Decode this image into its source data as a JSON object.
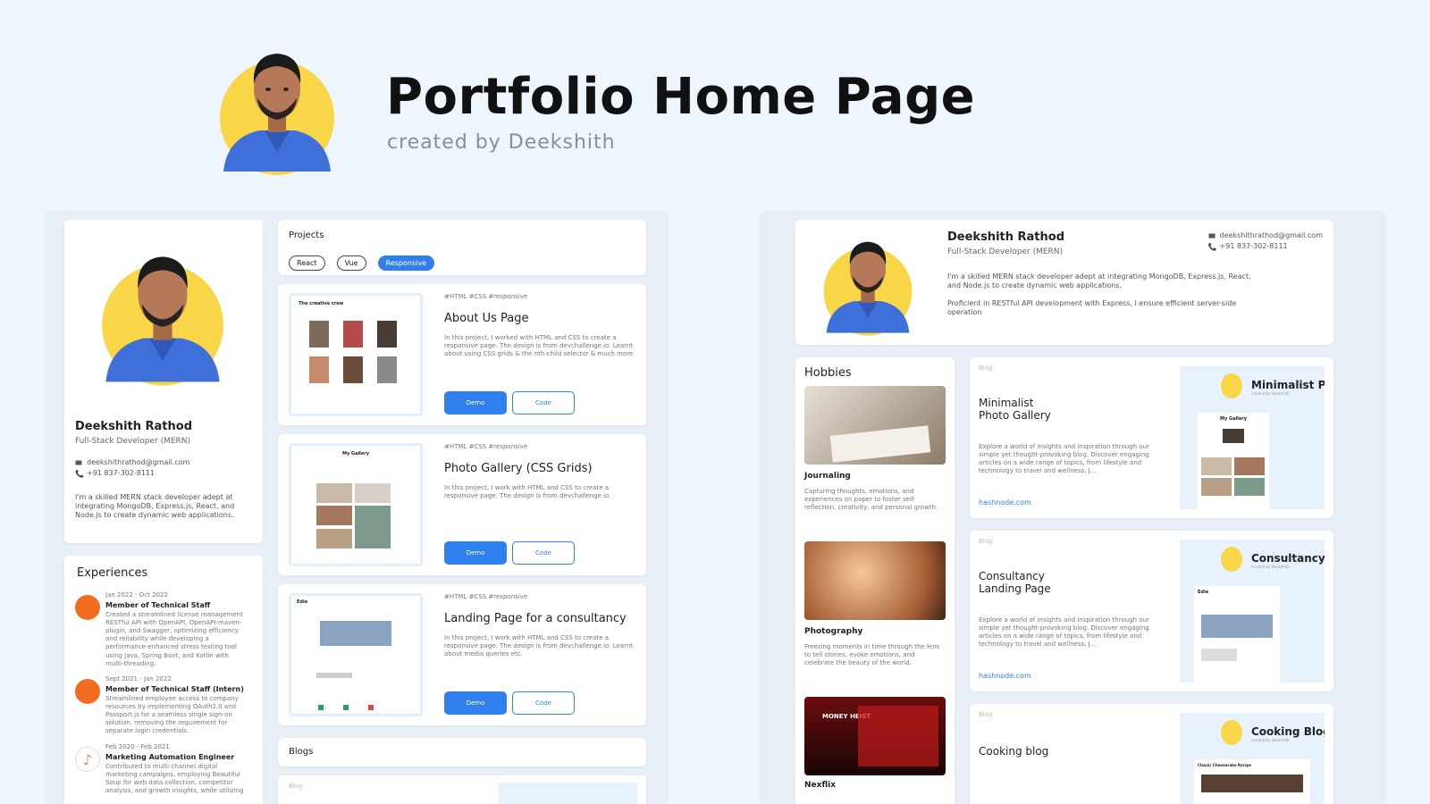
{
  "header": {
    "title": "Portfolio Home Page",
    "subtitle": "created by Deekshith"
  },
  "colors": {
    "accent": "#2f80ed",
    "avatar_bg": "#f9d648",
    "shirt": "#3f6fd8",
    "page_bg": "#eef5fd"
  },
  "left": {
    "profile": {
      "name": "Deekshith Rathod",
      "role": "Full-Stack Developer (MERN)",
      "email": "deekshithrathod@gmail.com",
      "phone": "+91 837-302-8111",
      "bio": "I'm a skilled MERN stack developer adept at integrating MongoDB, Express.js, React, and Node.js to create dynamic web applications."
    },
    "experiences": {
      "title": "Experiences",
      "items": [
        {
          "date": "Jan 2022 - Oct 2022",
          "title": "Member of Technical Staff",
          "desc": "Created a streamlined license management RESTful API with OpenAPI, OpenAPI-maven-plugin, and Swagger, optimizing efficiency and reliability while developing a performance-enhanced stress testing tool using Java, Spring Boot, and Kotlin with multi-threading."
        },
        {
          "date": "Sept 2021 - Jan 2022",
          "title": "Member of Technical Staff (Intern)",
          "desc": "Streamlined employee access to company resources by implementing OAuth2.0 and Passport.js for a seamless single sign-on solution, removing the requirement for separate login credentials."
        },
        {
          "date": "Feb 2020 - Feb 2021",
          "title": "Marketing Automation Engineer",
          "desc": "Contributed to multi-channel digital marketing campaigns, employing Beautiful Soup for web data collection, competitor analysis, and growth insights, while utilizing"
        }
      ]
    },
    "projects": {
      "title": "Projects",
      "filters": [
        "React",
        "Vue",
        "Responsive"
      ],
      "active_filter": "Responsive",
      "items": [
        {
          "tags": "#HTML #CSS #responsive",
          "name": "About Us Page",
          "desc": "In this project, I worked with HTML and CSS to create a responsive page. The design is from devchallenge.io. Learnt about using CSS grids & the nth-child selector & much more",
          "demo": "Demo",
          "code": "Code",
          "thumb_title": "The creative crew"
        },
        {
          "tags": "#HTML #CSS #responsive",
          "name": "Photo Gallery (CSS Grids)",
          "desc": "In this project, I work with HTML and CSS to create a responsive page. The design is from devchallenge.io.",
          "demo": "Demo",
          "code": "Code",
          "thumb_title": "My Gallery"
        },
        {
          "tags": "#HTML #CSS #responsive",
          "name": "Landing Page for a consultancy",
          "desc": "In this project, I work with HTML and CSS to create a responsive page. The design is from devchallenge.io. Learnt about media queries etc.",
          "demo": "Demo",
          "code": "Code",
          "thumb_title": "Edie"
        }
      ]
    },
    "blogs": {
      "title": "Blogs",
      "first_label": "Blog"
    }
  },
  "right": {
    "profile": {
      "name": "Deekshith Rathod",
      "role": "Full-Stack Developer (MERN)",
      "email": "deekshithrathod@gmail.com",
      "phone": "+91 837-302-8111",
      "bio1": "I'm a skilled MERN stack developer adept at integrating MongoDB, Express.js, React, and Node.js to create dynamic web applications.",
      "bio2": "Proficient in RESTful API development with Express, I ensure efficient server-side operation"
    },
    "hobbies": {
      "title": "Hobbies",
      "items": [
        {
          "name": "Journaling",
          "desc": "Capturing thoughts, emotions, and experiences on paper to foster self-reflection, creativity, and personal growth."
        },
        {
          "name": "Photography",
          "desc": "Freezing moments in time through the lens to tell stories, evoke emotions, and celebrate the beauty of the world."
        },
        {
          "name": "Nexflix",
          "desc": ""
        }
      ],
      "netflix_banner": "MONEY HEIST"
    },
    "blogs": [
      {
        "label": "Blog",
        "title_line1": "Minimalist",
        "title_line2": "Photo Gallery",
        "desc": "Explore a world of insights and inspiration through our simple yet thought-provoking blog. Discover engaging articles on a wide range of topics, from lifestyle and technology to travel and wellness. J...",
        "link": "hashnode.com",
        "preview_title": "Minimalist Pl",
        "preview_sub": "created by Deekshith",
        "preview_inner": "My Gallery"
      },
      {
        "label": "Blog",
        "title_line1": "Consultancy",
        "title_line2": "Landing Page",
        "desc": "Explore a world of insights and inspiration through our simple yet thought-provoking blog. Discover engaging articles on a wide range of topics, from lifestyle and technology to travel and wellness. J...",
        "link": "hashnode.com",
        "preview_title": "Consultancy",
        "preview_sub": "created by Deekshith",
        "preview_inner": "Edie"
      },
      {
        "label": "Blog",
        "title_line1": "Cooking blog",
        "title_line2": "",
        "desc": "",
        "link": "",
        "preview_title": "Cooking Blog",
        "preview_sub": "created by Deekshith",
        "preview_inner": "Classic Cheesecake Recipe"
      }
    ]
  }
}
